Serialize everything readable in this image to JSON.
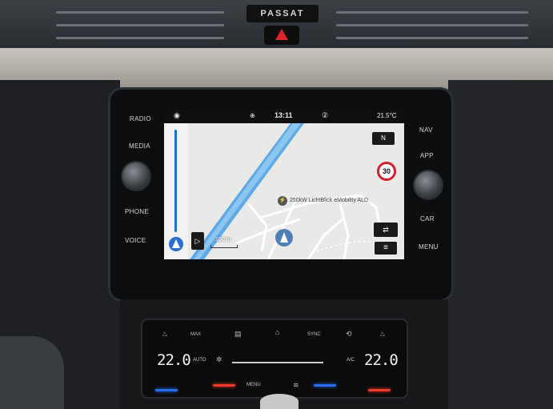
{
  "dashboard": {
    "brand": "PASSAT",
    "colors": {
      "hazard": "#e0242b",
      "accent_blue": "#1d6fd0",
      "temp_red": "#f03a2b",
      "temp_blue": "#2b6cf0"
    }
  },
  "infotainment": {
    "left_buttons": [
      "RADIO",
      "MEDIA",
      "PHONE",
      "VOICE"
    ],
    "right_buttons": [
      "NAV",
      "APP",
      "CAR",
      "MENU"
    ]
  },
  "screen": {
    "status": {
      "clock": "13:11",
      "temperature": "21.5°C",
      "mid_indicator": "②"
    },
    "map": {
      "speed_limit": "30",
      "poi_label": "250kW LichtBlick eMobility ALD",
      "poi_icon": "charging-station-icon",
      "scale_label": "100 m",
      "north_button_label": "N",
      "menu_button_label": "≡"
    }
  },
  "climate": {
    "left_temp": "22.0",
    "right_temp": "22.0",
    "labels": {
      "auto": "AUTO",
      "ac": "A/C",
      "menu": "MENU",
      "sync": "SYNC",
      "max": "MAX"
    }
  }
}
